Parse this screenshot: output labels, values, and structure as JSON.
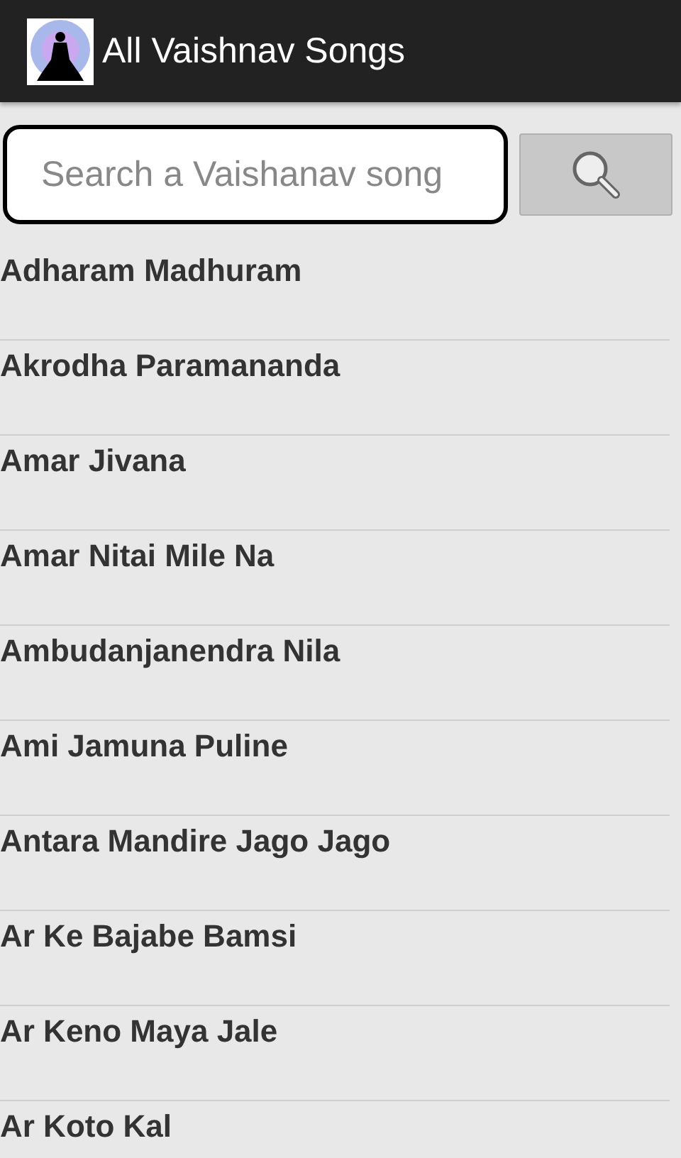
{
  "app_bar": {
    "title": "All Vaishnav Songs"
  },
  "search": {
    "placeholder": "Search a Vaishanav song"
  },
  "songs": [
    {
      "title": "Adharam Madhuram"
    },
    {
      "title": "Akrodha Paramananda"
    },
    {
      "title": "Amar Jivana"
    },
    {
      "title": "Amar Nitai Mile Na"
    },
    {
      "title": "Ambudanjanendra Nila"
    },
    {
      "title": "Ami Jamuna Puline"
    },
    {
      "title": "Antara Mandire Jago Jago"
    },
    {
      "title": "Ar Ke Bajabe Bamsi"
    },
    {
      "title": "Ar Keno Maya Jale"
    },
    {
      "title": "Ar Koto Kal"
    }
  ]
}
